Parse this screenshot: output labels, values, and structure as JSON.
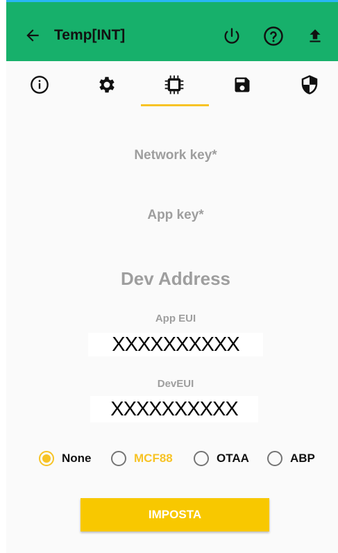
{
  "header": {
    "title": "Temp[INT]",
    "back_icon": "arrow-left-icon",
    "power_icon": "power-icon",
    "help_icon": "help-circle-icon",
    "upload_icon": "upload-icon",
    "background_color": "#17b06b"
  },
  "tabs": [
    {
      "icon": "info-icon",
      "selected": false
    },
    {
      "icon": "gear-icon",
      "selected": false
    },
    {
      "icon": "chip-icon",
      "selected": true
    },
    {
      "icon": "save-icon",
      "selected": false
    },
    {
      "icon": "shield-icon",
      "selected": false
    }
  ],
  "form": {
    "network_key_label": "Network key*",
    "app_key_label": "App key*",
    "dev_address_label": "Dev Address",
    "app_eui_label": "App EUI",
    "app_eui_value": "XXXXXXXXXX",
    "dev_eui_label": "DevEUI",
    "dev_eui_value": "XXXXXXXXXX"
  },
  "radio_options": [
    {
      "label": "None",
      "selected": true
    },
    {
      "label": "MCF88",
      "selected": false,
      "highlight": true
    },
    {
      "label": "OTAA",
      "selected": false
    },
    {
      "label": "ABP",
      "selected": false
    }
  ],
  "accent_color": "#f7c325",
  "submit_label": "IMPOSTA"
}
